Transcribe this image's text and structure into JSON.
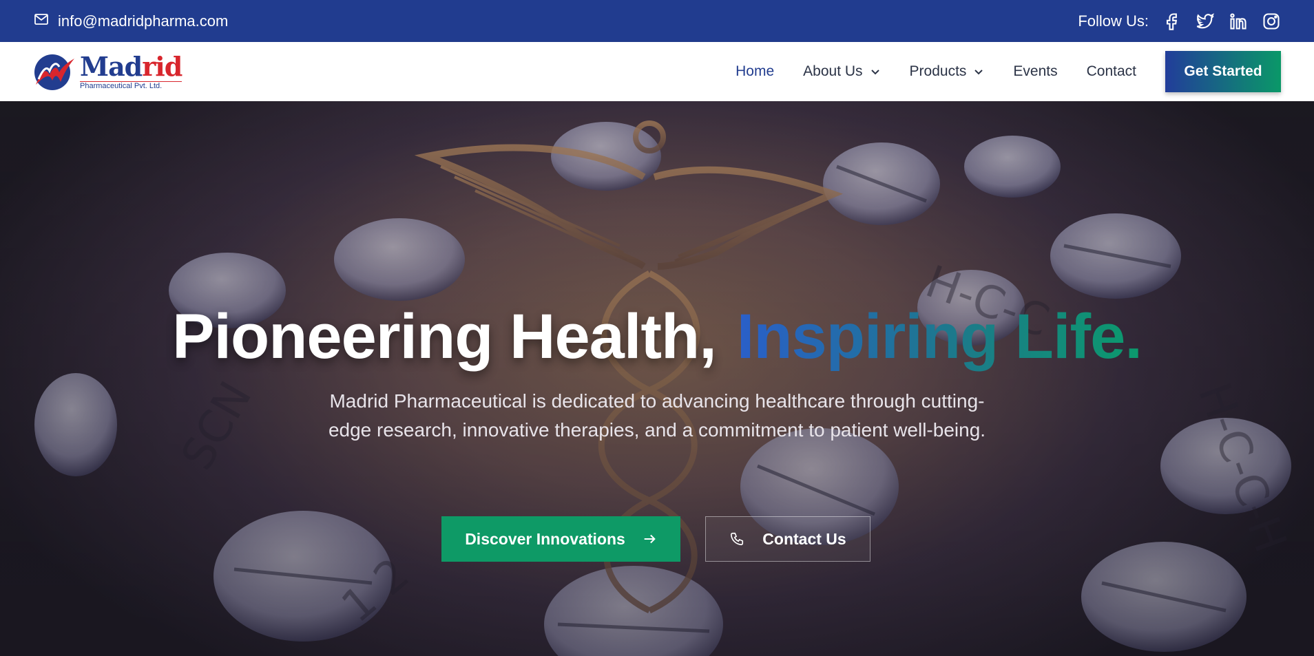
{
  "topbar": {
    "email": "info@madridpharma.com",
    "follow_label": "Follow Us:",
    "social_icons": [
      "facebook-icon",
      "twitter-icon",
      "linkedin-icon",
      "instagram-icon"
    ]
  },
  "logo": {
    "brand_part1": "Mad",
    "brand_part2": "rid",
    "subtitle": "Pharmaceutical Pvt. Ltd."
  },
  "nav": {
    "items": [
      {
        "label": "Home",
        "active": true
      },
      {
        "label": "About Us",
        "dropdown": true
      },
      {
        "label": "Products",
        "dropdown": true
      },
      {
        "label": "Events"
      },
      {
        "label": "Contact"
      }
    ],
    "cta_label": "Get Started"
  },
  "hero": {
    "headline_main": "Pioneering Health,",
    "headline_accent": "Inspiring Life.",
    "tagline": "Madrid Pharmaceutical is dedicated to advancing healthcare through cutting-edge research, innovative therapies, and a commitment to patient well-being.",
    "primary_button": "Discover Innovations",
    "secondary_button": "Contact Us"
  },
  "colors": {
    "topbar_bg": "#213c8f",
    "brand_blue": "#223d8f",
    "brand_red": "#d8262d",
    "green": "#0e9a66"
  }
}
